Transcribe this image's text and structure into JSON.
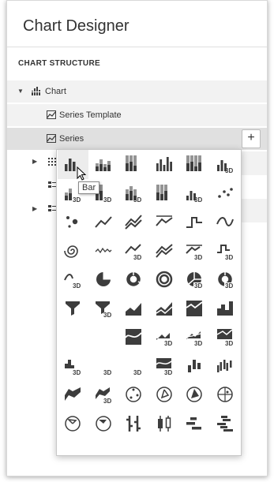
{
  "window": {
    "title": "Chart Designer"
  },
  "panel": {
    "section_label": "CHART STRUCTURE"
  },
  "tree": {
    "chart_label": "Chart",
    "series_template_label": "Series Template",
    "series_label": "Series",
    "add_button_label": "+"
  },
  "tooltip": {
    "text": "Bar"
  },
  "colors": {
    "icon": "#3d3d3d",
    "selected_row": "#e0e0e0",
    "row": "#f2f2f2"
  },
  "series_view_icons": [
    "bar-icon",
    "stacked-bar-icon",
    "full-stacked-bar-icon",
    "side-by-side-stacked-bar-icon",
    "side-by-side-full-stacked-bar-icon",
    "bar-3d-icon",
    "stacked-bar-3d-icon",
    "full-stacked-bar-3d-icon",
    "side-by-side-stacked-bar-3d-icon",
    "side-by-side-full-stacked-bar-3d-icon",
    "manhattan-bar-3d-icon",
    "point-icon",
    "bubble-icon",
    "line-icon",
    "stacked-line-icon",
    "full-stacked-line-icon",
    "step-line-icon",
    "spline-icon",
    "swift-plot-icon",
    "scatter-line-icon",
    "line-3d-icon",
    "stacked-line-3d-icon",
    "full-stacked-line-3d-icon",
    "step-line-3d-icon",
    "spline-3d-icon",
    "pie-icon",
    "doughnut-icon",
    "nested-doughnut-icon",
    "pie-3d-icon",
    "doughnut-3d-icon",
    "funnel-icon",
    "funnel-3d-icon",
    "area-icon",
    "stacked-area-icon",
    "full-stacked-area-icon",
    "step-area-icon",
    "spline-area-icon",
    "stacked-spline-area-icon",
    "full-stacked-spline-area-icon",
    "area-3d-icon",
    "stacked-area-3d-icon",
    "full-stacked-area-3d-icon",
    "step-area-3d-icon",
    "spline-area-3d-icon",
    "stacked-spline-area-3d-icon",
    "full-stacked-spline-area-3d-icon",
    "range-bar-icon",
    "side-by-side-range-bar-icon",
    "range-area-icon",
    "range-area-3d-icon",
    "radar-point-icon",
    "radar-line-icon",
    "radar-area-icon",
    "polar-point-icon",
    "polar-line-icon",
    "polar-area-icon",
    "stock-icon",
    "candle-stick-icon",
    "gantt-icon",
    "side-by-side-gantt-icon"
  ]
}
